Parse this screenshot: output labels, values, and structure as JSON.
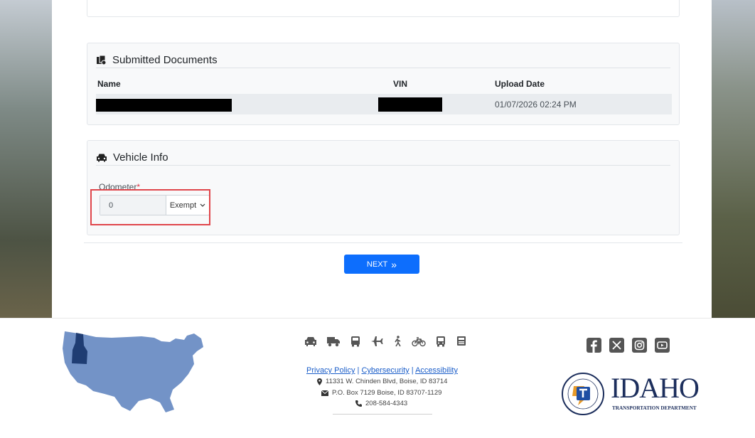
{
  "submitted_documents": {
    "title": "Submitted Documents",
    "columns": [
      "Name",
      "VIN",
      "Upload Date"
    ],
    "rows": [
      {
        "name": "",
        "vin": "",
        "upload_date": "01/07/2026 02:24 PM"
      }
    ]
  },
  "vehicle_info": {
    "title": "Vehicle Info",
    "odometer_label": "Odometer",
    "required_mark": "*",
    "odometer_value": "0",
    "odometer_status": "Exempt"
  },
  "actions": {
    "next_label": "NEXT",
    "next_icon": "»"
  },
  "footer": {
    "transport_icons": [
      "car-icon",
      "truck-icon",
      "bus-icon",
      "airplane-icon",
      "pedestrian-icon",
      "bicycle-icon",
      "transit-icon",
      "rail-icon"
    ],
    "links": [
      "Privacy Policy",
      "Cybersecurity",
      "Accessibility"
    ],
    "separator": "|",
    "address": "11331 W. Chinden Blvd, Boise, ID 83714",
    "po_box": "P.O. Box 7129 Boise, ID 83707-1129",
    "phone": "208-584-4343",
    "social_icons": [
      "facebook-icon",
      "x-icon",
      "instagram-icon",
      "youtube-icon"
    ],
    "logo_word": "IDAHO",
    "logo_sub": "TRANSPORTATION DEPARTMENT",
    "seal_text": "IDAHO TRANSPORTATION DEPARTMENT"
  },
  "colors": {
    "primary": "#0d6efd",
    "highlight": "#e0464b",
    "required": "#dc3545",
    "map_fill": "#7393c7",
    "idaho_fill": "#1f3d73",
    "logo_text": "#1c2e5c",
    "link": "#1a5dc9"
  }
}
